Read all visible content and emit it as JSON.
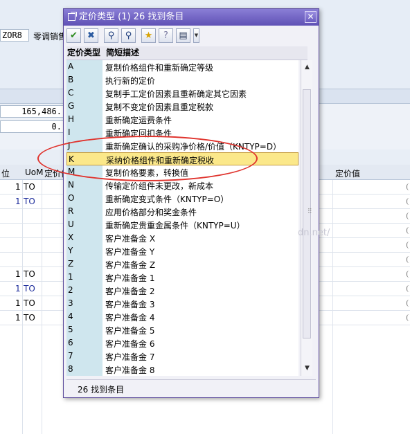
{
  "background": {
    "order_type_code": "ZOR8",
    "order_type_label": "零调销售",
    "amount_1": "165,486.",
    "amount_2": "0.",
    "grid_headers": {
      "col_unit": "位",
      "col_uom": "UoM",
      "col_price": "定价值",
      "col_price_value": "定价值"
    },
    "grid_rows": [
      {
        "qty": "1",
        "uom": "TO",
        "blue": false
      },
      {
        "qty": "1",
        "uom": "TO",
        "blue": true
      },
      {
        "qty": "",
        "uom": "",
        "blue": false
      },
      {
        "qty": "",
        "uom": "",
        "blue": false
      },
      {
        "qty": "",
        "uom": "",
        "blue": false
      },
      {
        "qty": "",
        "uom": "",
        "blue": false
      },
      {
        "qty": "1",
        "uom": "TO",
        "blue": false
      },
      {
        "qty": "1",
        "uom": "TO",
        "blue": true
      },
      {
        "qty": "1",
        "uom": "TO",
        "blue": false
      },
      {
        "qty": "1",
        "uom": "TO",
        "blue": false
      }
    ]
  },
  "dialog": {
    "title": "定价类型 (1)   26 找到条目",
    "close_label": "✕",
    "toolbar": [
      {
        "name": "ok-icon",
        "glyph": "✔",
        "color": "#2a8a1a"
      },
      {
        "name": "cancel-icon",
        "glyph": "✖",
        "color": "#2a5aa0"
      },
      {
        "name": "find-icon",
        "glyph": "⚲",
        "color": "#1a3a7a"
      },
      {
        "name": "find-next-icon",
        "glyph": "⚲",
        "color": "#1a3a7a"
      },
      {
        "name": "favorite-add-icon",
        "glyph": "★",
        "color": "#d8a200"
      },
      {
        "name": "help-icon",
        "glyph": "?",
        "color": "#7a7aa0"
      },
      {
        "name": "print-icon",
        "glyph": "▤",
        "color": "#2a3a5a"
      },
      {
        "name": "dropdown-icon",
        "glyph": "▼",
        "color": "#333333"
      }
    ],
    "columns": {
      "code": "定价类型",
      "desc": "简短描述"
    },
    "rows": [
      {
        "code": "A",
        "desc": "复制价格组件和重新确定等级"
      },
      {
        "code": "B",
        "desc": "执行新的定价"
      },
      {
        "code": "C",
        "desc": "复制手工定价因素且重新确定其它因素"
      },
      {
        "code": "G",
        "desc": "复制不变定价因素且重定税款"
      },
      {
        "code": "H",
        "desc": "重新确定运费条件"
      },
      {
        "code": "I",
        "desc": "重新确定回扣条件"
      },
      {
        "code": "J",
        "desc": "重新确定确认的采购净价格/价值（KNTYP=D）"
      },
      {
        "code": "K",
        "desc": "采纳价格组件和重新确定税收"
      },
      {
        "code": "M",
        "desc": "复制价格要素，转换值"
      },
      {
        "code": "N",
        "desc": "传输定价组件未更改，新成本"
      },
      {
        "code": "O",
        "desc": "重新确定变式条件（KNTYP=O）"
      },
      {
        "code": "R",
        "desc": "应用价格部分和奖金条件"
      },
      {
        "code": "U",
        "desc": "重新确定贵重金属条件（KNTYP=U）"
      },
      {
        "code": "X",
        "desc": "客户准备金 X"
      },
      {
        "code": "Y",
        "desc": "客户准备金 Y"
      },
      {
        "code": "Z",
        "desc": "客户准备金 Z"
      },
      {
        "code": "1",
        "desc": "客户准备金 1"
      },
      {
        "code": "2",
        "desc": "客户准备金 2"
      },
      {
        "code": "3",
        "desc": "客户准备金 3"
      },
      {
        "code": "4",
        "desc": "客户准备金 4"
      },
      {
        "code": "5",
        "desc": "客户准备金 5"
      },
      {
        "code": "6",
        "desc": "客户准备金 6"
      },
      {
        "code": "7",
        "desc": "客户准备金 7"
      },
      {
        "code": "8",
        "desc": "客户准备金 8"
      }
    ],
    "selected_code": "K",
    "scroll_up": "▲",
    "scroll_down": "▼",
    "status": "26 找到条目",
    "watermark": "dn.net/"
  },
  "colors": {
    "title_bar": "#6b5fc7",
    "code_column": "#cfe6ee",
    "selection": "#fbe88a",
    "annotation": "#e0342e"
  }
}
